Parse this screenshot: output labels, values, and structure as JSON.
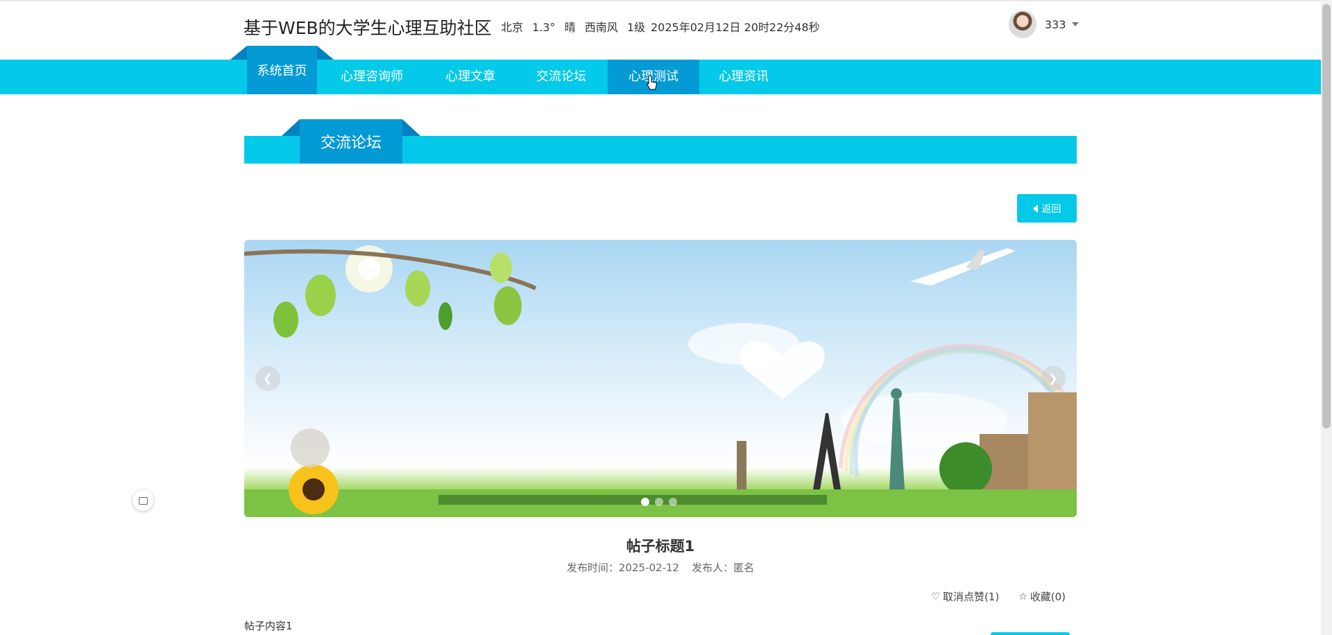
{
  "header": {
    "site_title": "基于WEB的大学生心理互助社区",
    "weather": {
      "city": "北京",
      "temperature": "1.3°",
      "condition": "晴",
      "wind": "西南风",
      "level": "1级"
    },
    "datetime": "2025年02月12日 20时22分48秒",
    "user": {
      "name": "333",
      "avatar_icon": "user-avatar"
    }
  },
  "nav": {
    "items": [
      {
        "label": "系统首页"
      },
      {
        "label": "心理咨询师"
      },
      {
        "label": "心理文章"
      },
      {
        "label": "交流论坛"
      },
      {
        "label": "心理测试"
      },
      {
        "label": "心理资讯"
      }
    ],
    "hovered": "心理测试"
  },
  "section": {
    "title": "交流论坛"
  },
  "back_button": {
    "label": "返回",
    "icon": "caret-left-icon"
  },
  "carousel": {
    "prev_icon": "chevron-left-icon",
    "next_icon": "chevron-right-icon",
    "active_slide": 1,
    "slide_count": 3
  },
  "post": {
    "title": "帖子标题1",
    "time_label": "发布时间：",
    "time": "2025-02-12",
    "author_label": "发布人：",
    "author": "匿名",
    "like": {
      "label": "取消点赞(1)",
      "icon": "heart-icon"
    },
    "favorite": {
      "label": "收藏(0)",
      "icon": "star-icon"
    },
    "content": "帖子内容1"
  },
  "colors": {
    "nav_bg": "#04c9e8",
    "nav_active": "#039ad6",
    "accent_dark": "#0380c0"
  }
}
